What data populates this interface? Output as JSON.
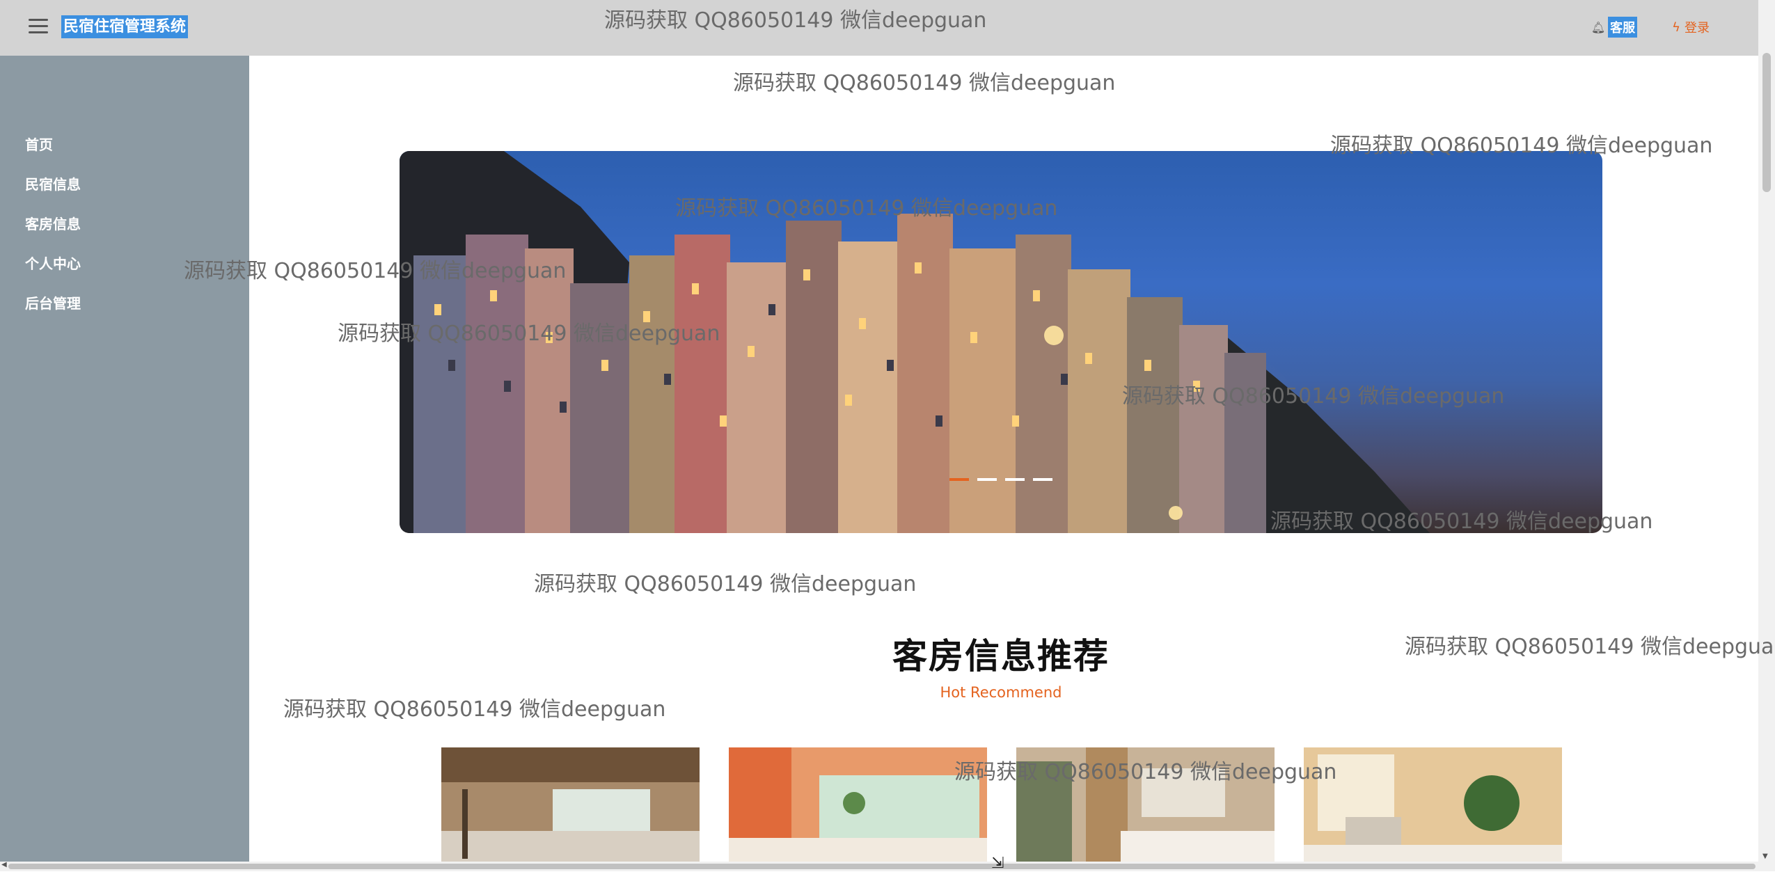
{
  "header": {
    "app_title": "民宿住宿管理系统",
    "kefu_label": "客服",
    "login_label": "登录",
    "icons": {
      "menu": "hamburger-icon",
      "kefu": "bell-icon",
      "login": "bolt-icon"
    }
  },
  "sidebar": {
    "items": [
      {
        "label": "首页"
      },
      {
        "label": "民宿信息"
      },
      {
        "label": "客房信息"
      },
      {
        "label": "个人中心"
      },
      {
        "label": "后台管理"
      }
    ]
  },
  "banner": {
    "slide_count": 4,
    "active_index": 0
  },
  "recommend": {
    "title": "客房信息推荐",
    "subtitle": "Hot Recommend",
    "cards": [
      {
        "image": "room-photo-wooden-living"
      },
      {
        "image": "room-photo-orange-lounge"
      },
      {
        "image": "room-photo-bedroom-screen"
      },
      {
        "image": "room-photo-bedroom-plant"
      }
    ]
  },
  "watermark": {
    "text": "源码获取 QQ86050149 微信deepguan"
  },
  "colors": {
    "accent": "#e4631f",
    "topbar": "#d3d3d3",
    "sidebar": "#8c9aa3",
    "title_highlight": "#3b8fe0"
  }
}
